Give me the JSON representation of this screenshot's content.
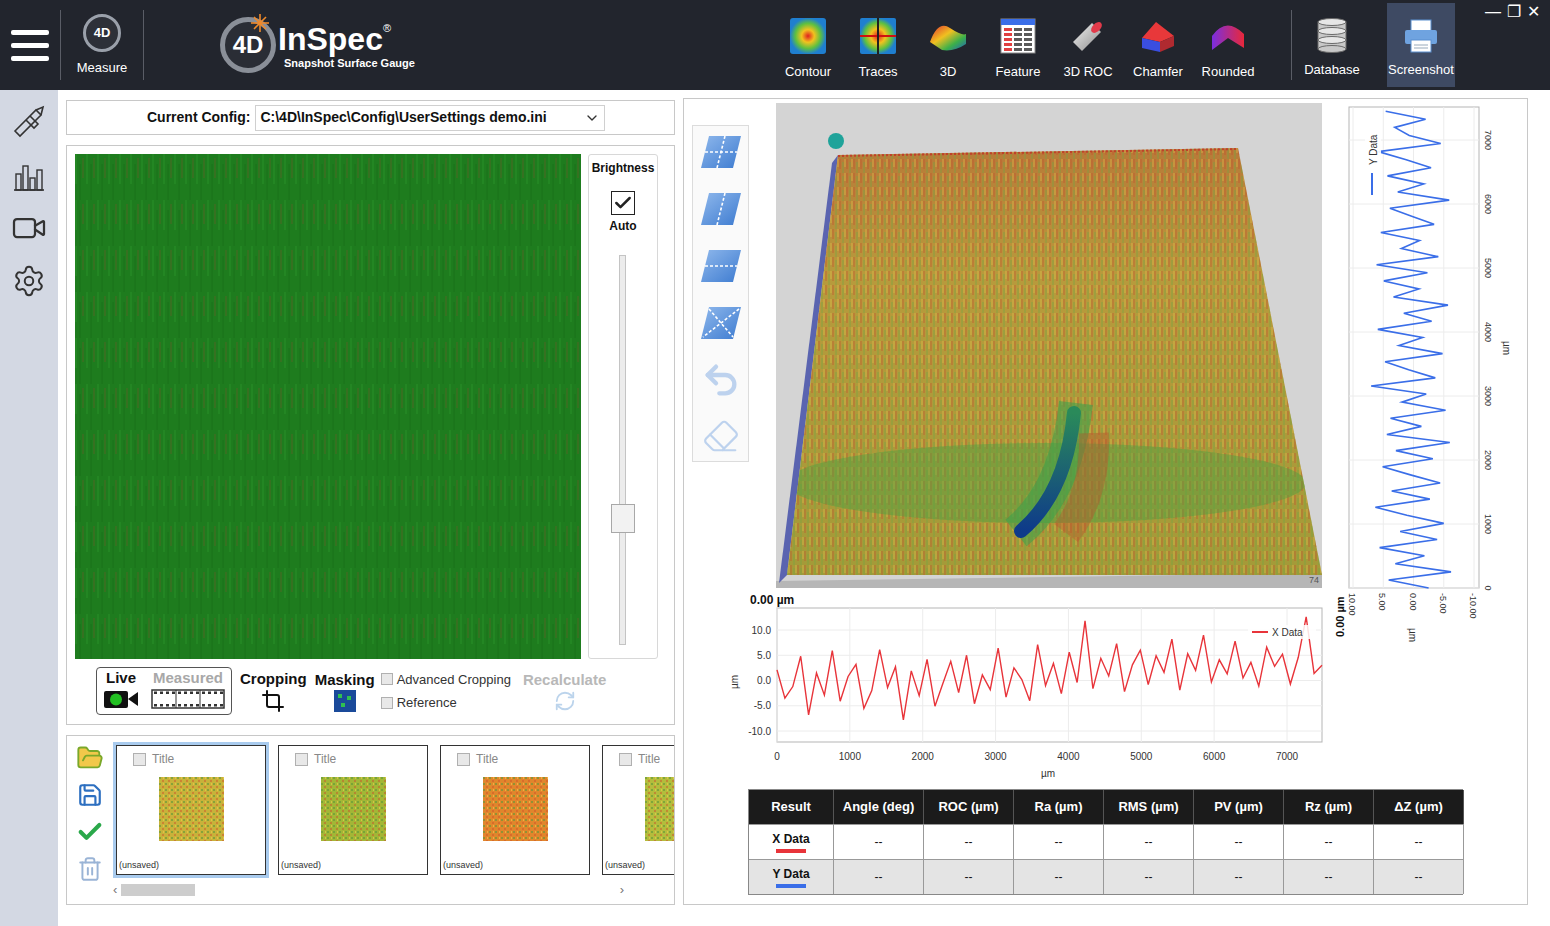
{
  "window": {
    "controls": [
      "—",
      "❐",
      "✕"
    ]
  },
  "topbar": {
    "measure": {
      "icon_text": "4D",
      "label": "Measure"
    },
    "logo": {
      "mark": "4D",
      "name": "InSpec",
      "registered": "®",
      "tagline": "Snapshot Surface Gauge"
    },
    "views": [
      {
        "label": "Contour",
        "kind": "contour",
        "selected": false
      },
      {
        "label": "Traces",
        "kind": "traces",
        "selected": false
      },
      {
        "label": "3D",
        "kind": "surface",
        "selected": false
      },
      {
        "label": "Feature",
        "kind": "feature",
        "selected": false
      },
      {
        "label": "3D ROC",
        "kind": "roc",
        "selected": false
      },
      {
        "label": "Chamfer",
        "kind": "chamfer",
        "selected": false
      },
      {
        "label": "Rounded",
        "kind": "rounded",
        "selected": false
      }
    ],
    "actions": [
      {
        "label": "Database",
        "kind": "database",
        "selected": false
      },
      {
        "label": "Screenshot",
        "kind": "printer",
        "selected": true
      }
    ]
  },
  "sidebar": {
    "items": [
      {
        "kind": "caliper",
        "selected": false
      },
      {
        "kind": "chart",
        "selected": false
      },
      {
        "kind": "camera",
        "selected": false
      },
      {
        "kind": "gear",
        "selected": false
      }
    ]
  },
  "config": {
    "label": "Current Config:",
    "value": "C:\\4D\\InSpec\\Config\\UserSettings demo.ini"
  },
  "camera": {
    "brightness": {
      "label": "Brightness",
      "auto": {
        "label": "Auto",
        "checked": true
      },
      "level": 0.31
    },
    "modes": [
      {
        "label": "Live",
        "kind": "live",
        "selected": true
      },
      {
        "label": "Measured",
        "kind": "film",
        "selected": false
      }
    ],
    "tools": [
      {
        "label": "Cropping",
        "kind": "crop"
      },
      {
        "label": "Masking",
        "kind": "mask"
      }
    ],
    "options": [
      {
        "label": "Advanced Cropping",
        "checked": false
      },
      {
        "label": "Reference",
        "checked": false
      }
    ],
    "recalculate": {
      "label": "Recalculate",
      "disabled": true
    }
  },
  "gallery": {
    "actions": [
      {
        "kind": "open"
      },
      {
        "kind": "save"
      },
      {
        "kind": "accept"
      },
      {
        "kind": "delete"
      }
    ],
    "items": [
      {
        "title": "Title",
        "checked": false,
        "status": "(unsaved)",
        "selected": true,
        "color": "#c8b23a"
      },
      {
        "title": "Title",
        "checked": false,
        "status": "(unsaved)",
        "selected": false,
        "color": "#a3b636"
      },
      {
        "title": "Title",
        "checked": false,
        "status": "(unsaved)",
        "selected": false,
        "color": "#e0862c"
      },
      {
        "title": "Title",
        "checked": false,
        "status": "(unsaved)",
        "selected": false,
        "color": "#b4bc3c"
      }
    ],
    "scroll": {
      "prev": "‹",
      "next": "›",
      "level": 0.15
    }
  },
  "view3d": {
    "corner_label": "74",
    "tools": [
      {
        "kind": "plane-grid",
        "disabled": false
      },
      {
        "kind": "plane-vertical",
        "disabled": false
      },
      {
        "kind": "plane-horizontal",
        "disabled": false
      },
      {
        "kind": "plane-cross",
        "disabled": false
      },
      {
        "kind": "undo",
        "disabled": true
      },
      {
        "kind": "eraser",
        "disabled": true
      }
    ]
  },
  "x_chart": {
    "axis_label": "0.00 µm",
    "value_unit": "µm",
    "length_unit": "µm",
    "value_ticks": [
      "10.0",
      "5.0",
      "0.0",
      "-5.0",
      "-10.0"
    ],
    "length_ticks": [
      "0",
      "1000",
      "2000",
      "3000",
      "4000",
      "5000",
      "6000",
      "7000"
    ],
    "series": [
      {
        "name": "X Data",
        "color": "#e8343a",
        "values": [
          2.1,
          -3.5,
          -1.2,
          4.8,
          -6.8,
          1.5,
          -2.9,
          5.9,
          -4.1,
          0.8,
          3.2,
          -5.5,
          -2.0,
          6.1,
          -1.4,
          2.7,
          -7.8,
          1.9,
          -3.0,
          4.2,
          -5.1,
          -0.6,
          3.8,
          -2.4,
          5.0,
          -4.6,
          1.1,
          -1.8,
          6.4,
          -3.3,
          2.5,
          0.2,
          -4.0,
          7.1,
          -1.0,
          3.4,
          -2.6,
          5.6,
          -0.4,
          11.8,
          -1.6,
          4.4,
          0.9,
          7.3,
          -2.2,
          3.1,
          6.0,
          -0.8,
          4.9,
          1.6,
          8.2,
          -1.9,
          5.3,
          2.0,
          9.0,
          -0.3,
          4.1,
          1.3,
          7.8,
          0.5,
          3.6,
          -1.1,
          6.6,
          2.8,
          5.2,
          -0.7,
          4.6,
          12.6,
          1.4,
          3.0
        ]
      }
    ]
  },
  "y_chart": {
    "axis_label": "0.00 µm",
    "value_unit": "µm",
    "length_unit": "µm",
    "value_ticks": [
      "10.00",
      "5.00",
      "0.00",
      "-5.00",
      "-10.00"
    ],
    "length_ticks": [
      "0",
      "1000",
      "2000",
      "3000",
      "4000",
      "5000",
      "6000",
      "7000"
    ],
    "series": [
      {
        "name": "Y Data",
        "color": "#3a6ee8",
        "values": [
          -2.5,
          4.1,
          -6.2,
          3.0,
          -1.8,
          5.6,
          -3.9,
          2.2,
          -5.0,
          1.1,
          6.3,
          -2.7,
          3.6,
          -4.4,
          0.5,
          5.1,
          -3.2,
          2.9,
          -6.0,
          4.4,
          -1.3,
          3.8,
          -5.3,
          1.9,
          -2.1,
          7.0,
          -3.6,
          0.8,
          4.7,
          -4.8,
          2.4,
          -1.5,
          5.9,
          -3.0,
          1.6,
          -5.7,
          3.3,
          -0.9,
          4.9,
          -2.3,
          6.1,
          -4.1,
          2.0,
          -1.0,
          5.4,
          -3.4,
          0.3,
          3.9,
          -5.9,
          2.6,
          -1.7,
          4.3,
          -2.9,
          1.2,
          5.8,
          -4.5,
          0.7,
          3.1,
          -2.0,
          4.6
        ]
      }
    ]
  },
  "results": {
    "columns": [
      "Result",
      "Angle (deg)",
      "ROC (µm)",
      "Ra (µm)",
      "RMS (µm)",
      "PV (µm)",
      "Rz (µm)",
      "ΔZ (µm)"
    ],
    "rows": [
      {
        "label": "X Data",
        "color": "#e8343a",
        "cells": [
          "--",
          "--",
          "--",
          "--",
          "--",
          "--",
          "--"
        ]
      },
      {
        "label": "Y Data",
        "color": "#3a6ee8",
        "cells": [
          "--",
          "--",
          "--",
          "--",
          "--",
          "--",
          "--"
        ]
      }
    ]
  }
}
